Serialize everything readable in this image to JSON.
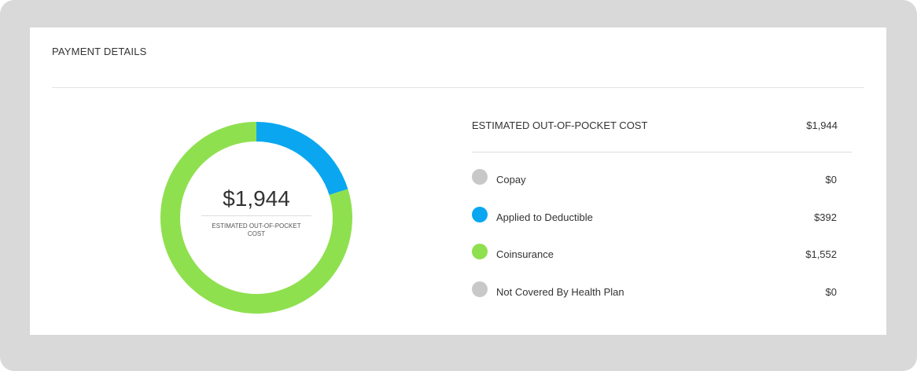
{
  "panel": {
    "title": "PAYMENT DETAILS"
  },
  "summary": {
    "label": "ESTIMATED OUT-OF-POCKET COST",
    "value": "$1,944"
  },
  "donut_center": {
    "value": "$1,944",
    "caption": "ESTIMATED OUT-OF-POCKET COST"
  },
  "chart_data": {
    "type": "pie",
    "categories": [
      "Copay",
      "Applied to Deductible",
      "Coinsurance",
      "Not Covered By Health Plan"
    ],
    "values": [
      0,
      392,
      1552,
      0
    ],
    "value_labels": [
      "$0",
      "$392",
      "$1,552",
      "$0"
    ],
    "colors": [
      "#c8c8c8",
      "#0aa7f0",
      "#8fe04f",
      "#c8c8c8"
    ],
    "total": 1944,
    "total_label": "$1,944",
    "style": "donut",
    "legend_placement": "right"
  }
}
